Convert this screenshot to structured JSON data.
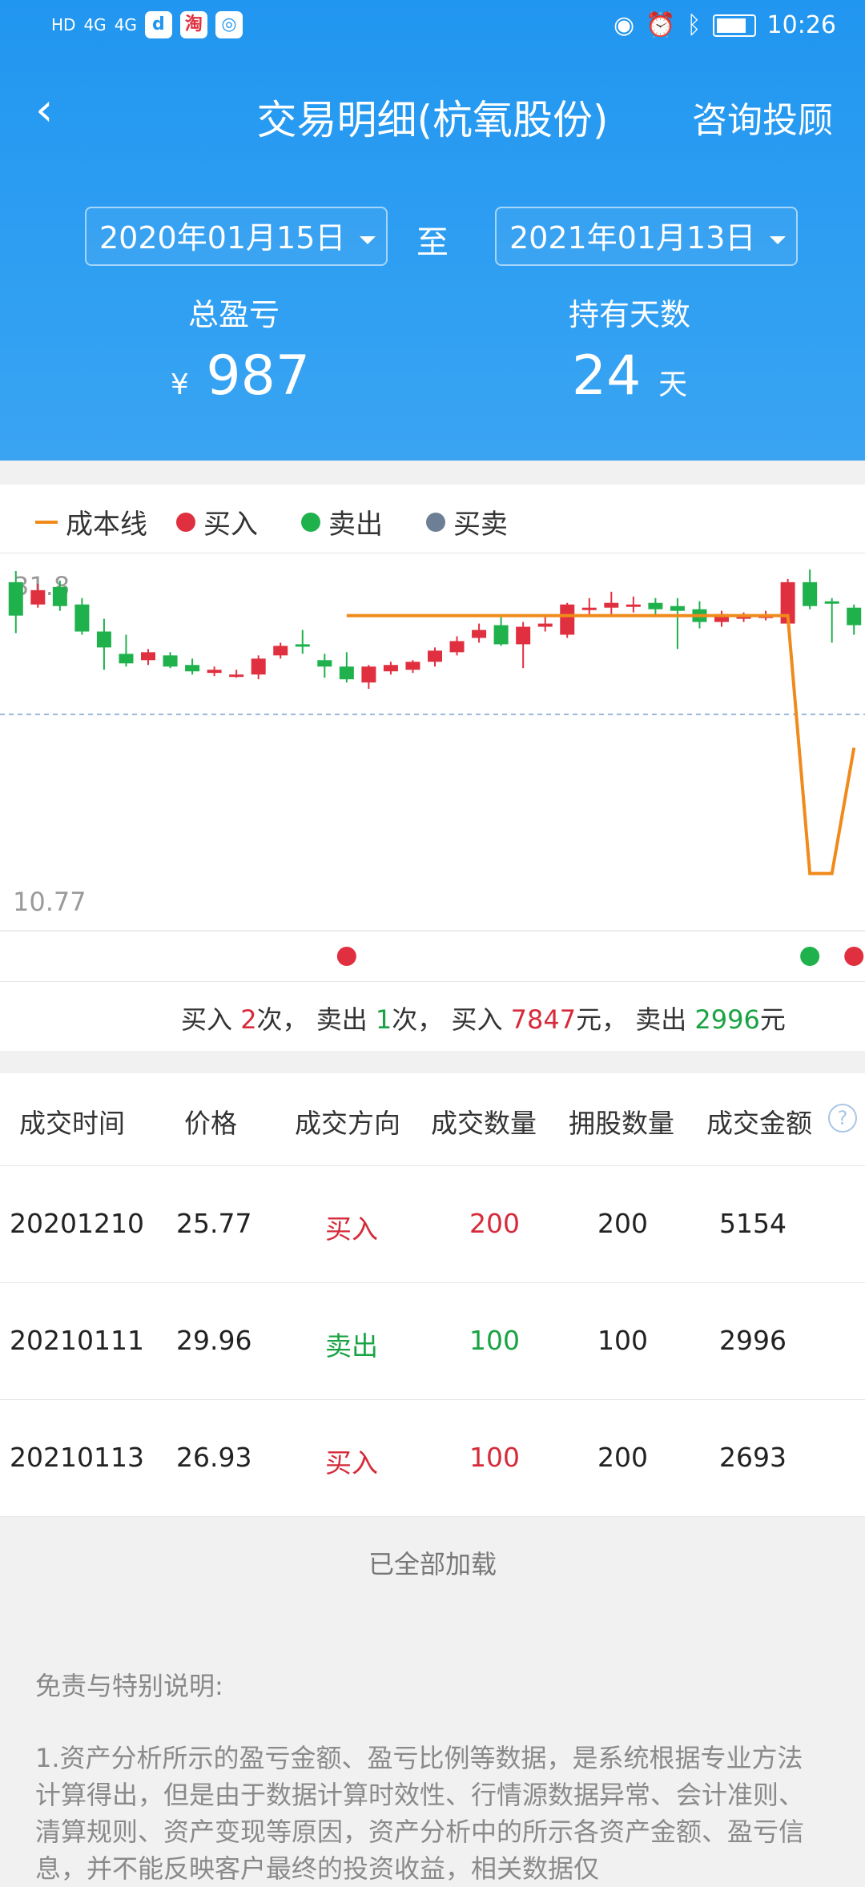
{
  "status_bar": {
    "left": [
      "HD",
      "4G",
      "4G"
    ],
    "time": "10:26"
  },
  "nav": {
    "back_icon": "back-arrow",
    "title": "交易明细(杭氧股份)",
    "consult": "咨询投顾"
  },
  "filters": {
    "start_date": "2020年01月15日",
    "to": "至",
    "end_date": "2021年01月13日"
  },
  "stats": {
    "pnl_label": "总盈亏",
    "pnl_currency": "¥",
    "pnl_value": "987",
    "days_label": "持有天数",
    "days_value": "24",
    "days_unit": "天"
  },
  "legend": {
    "cost_line": "成本线",
    "buy": "买入",
    "sell": "卖出",
    "buy_sell": "买卖",
    "colors": {
      "cost_line": "#f08a1b",
      "buy": "#e03040",
      "sell": "#1fb14c",
      "buy_sell": "#6d7f95"
    }
  },
  "chart_data": {
    "type": "candlestick",
    "ylim": [
      10.77,
      31.8
    ],
    "y_top_label": "31.8",
    "y_bottom_label": "10.77",
    "candles": [
      [
        30.9,
        28.8,
        31.6,
        27.7
      ],
      [
        29.5,
        30.4,
        30.8,
        29.3
      ],
      [
        30.6,
        29.4,
        31.0,
        29.1
      ],
      [
        29.5,
        27.8,
        29.9,
        27.6
      ],
      [
        27.8,
        26.8,
        28.6,
        25.4
      ],
      [
        26.4,
        25.8,
        27.6,
        25.6
      ],
      [
        26.0,
        26.5,
        26.7,
        25.7
      ],
      [
        26.3,
        25.6,
        26.5,
        25.5
      ],
      [
        25.7,
        25.3,
        26.1,
        25.1
      ],
      [
        25.2,
        25.4,
        25.6,
        25.0
      ],
      [
        25.0,
        25.1,
        25.4,
        24.9
      ],
      [
        25.1,
        26.1,
        26.3,
        24.8
      ],
      [
        26.3,
        26.9,
        27.1,
        26.1
      ],
      [
        27.0,
        26.9,
        27.9,
        26.4
      ],
      [
        26.0,
        25.6,
        26.4,
        24.9
      ],
      [
        25.6,
        24.8,
        26.5,
        24.6
      ],
      [
        24.6,
        25.6,
        25.7,
        24.2
      ],
      [
        25.3,
        25.7,
        25.9,
        25.1
      ],
      [
        25.4,
        25.9,
        26.0,
        25.2
      ],
      [
        25.9,
        26.6,
        26.8,
        25.6
      ],
      [
        26.5,
        27.2,
        27.5,
        26.3
      ],
      [
        27.4,
        27.9,
        28.3,
        27.1
      ],
      [
        28.2,
        27.0,
        28.7,
        26.9
      ],
      [
        27.0,
        28.1,
        28.4,
        25.5
      ],
      [
        28.1,
        28.3,
        28.9,
        27.8
      ],
      [
        27.6,
        29.5,
        29.6,
        27.4
      ],
      [
        29.2,
        29.3,
        29.9,
        28.8
      ],
      [
        29.3,
        29.6,
        30.3,
        28.9
      ],
      [
        29.4,
        29.5,
        30.0,
        29.0
      ],
      [
        29.6,
        29.2,
        29.9,
        28.7
      ],
      [
        29.4,
        29.1,
        29.9,
        26.7
      ],
      [
        29.2,
        28.4,
        29.7,
        28.0
      ],
      [
        28.4,
        28.9,
        29.1,
        28.1
      ],
      [
        28.6,
        28.8,
        29.0,
        28.4
      ],
      [
        28.7,
        28.8,
        29.1,
        28.5
      ],
      [
        28.3,
        30.9,
        31.1,
        28.2
      ],
      [
        30.9,
        29.4,
        31.7,
        29.2
      ],
      [
        29.7,
        29.6,
        29.9,
        27.1
      ],
      [
        29.3,
        28.2,
        29.5,
        27.6
      ]
    ],
    "cost_line": [
      [
        15,
        28.8
      ],
      [
        35,
        28.8
      ],
      [
        36,
        12.6
      ],
      [
        37,
        12.6
      ],
      [
        38,
        20.5
      ]
    ],
    "dashed_level": 22.6
  },
  "trade_marks": [
    {
      "index": 15,
      "type": "buy"
    },
    {
      "index": 36,
      "type": "sell"
    },
    {
      "index": 38,
      "type": "buy"
    }
  ],
  "summary": {
    "buy_prefix": "买入 ",
    "buy_count": "2",
    "buy_suffix": "次，  卖出 ",
    "sell_count": "1",
    "sell_suffix": "次，  买入 ",
    "buy_amount": "7847",
    "buy_amount_suffix": "元，  卖出 ",
    "sell_amount": "2996",
    "sell_amount_suffix": "元"
  },
  "table": {
    "headers": [
      "成交时间",
      "价格",
      "成交方向",
      "成交数量",
      "拥股数量",
      "成交金额"
    ],
    "rows": [
      [
        "20201210",
        "25.77",
        "买入",
        "200",
        "200",
        "5154"
      ],
      [
        "20210111",
        "29.96",
        "卖出",
        "100",
        "100",
        "2996"
      ],
      [
        "20210113",
        "26.93",
        "买入",
        "100",
        "200",
        "2693"
      ]
    ]
  },
  "loaded_text": "已全部加载",
  "disclaimer": {
    "title": "免责与特别说明:",
    "body": "1.资产分析所示的盈亏金额、盈亏比例等数据，是系统根据专业方法计算得出，但是由于数据计算时效性、行情源数据异常、会计准则、清算规则、资产变现等原因，资产分析中的所示各资产金额、盈亏信息，并不能反映客户最终的投资收益，相关数据仅"
  }
}
